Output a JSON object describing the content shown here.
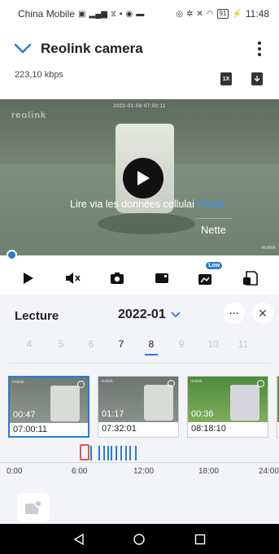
{
  "status_bar": {
    "carrier": "China Mobile",
    "battery": "91",
    "time": "11:48"
  },
  "app_bar": {
    "title": "Reolink camera",
    "back_icon": "chevron-down-icon",
    "menu_icon": "more-vertical-icon"
  },
  "stream": {
    "bitrate": "223,10 kbps",
    "speed_icon_label": "1X",
    "download_icon": "download-icon"
  },
  "video": {
    "overlay_timestamp": "2022-01-08 07:00:11",
    "cellular_prompt": "Lire via les données cellulai",
    "quality_options": [
      "Fluide",
      "Nette"
    ],
    "selected_quality": "Fluide",
    "accent_color": "#3d8df5",
    "progress": 0
  },
  "controls": {
    "items": [
      "play-icon",
      "mute-icon",
      "snapshot-icon",
      "record-icon",
      "quality-icon",
      "sd-card-icon"
    ],
    "quality_badge": "Low"
  },
  "playback": {
    "title": "Lecture",
    "month": "2022-01",
    "days": [
      "4",
      "5",
      "6",
      "7",
      "8",
      "9",
      "10",
      "11"
    ],
    "days_with_recordings": [
      "7",
      "8"
    ],
    "selected_day": "8"
  },
  "clips": [
    {
      "duration": "00:47",
      "time": "07:00:11",
      "selected": true
    },
    {
      "duration": "01:17",
      "time": "07:32:01",
      "selected": false
    },
    {
      "duration": "00:36",
      "time": "08:18:10",
      "selected": false
    }
  ],
  "timeline": {
    "labels": [
      "0:00",
      "6:00",
      "12:00",
      "18:00",
      "24:00"
    ],
    "marker_hour": 7.0,
    "recording_hours": [
      7.5,
      8.3,
      8.7,
      9.1,
      9.4,
      9.9,
      10.3,
      10.8,
      11.2,
      11.7
    ],
    "accent_color": "#2a7bd6",
    "marker_color": "#e25555"
  }
}
